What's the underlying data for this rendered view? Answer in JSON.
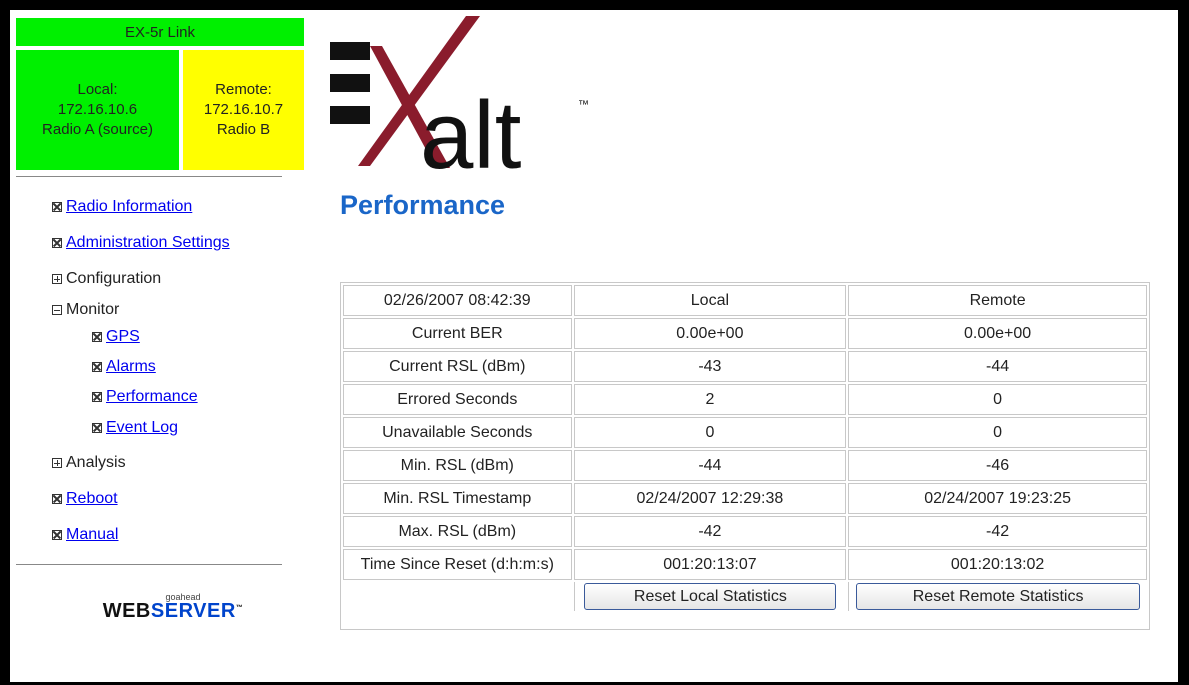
{
  "link_status": {
    "title": "EX-5r Link",
    "local": {
      "label": "Local:",
      "ip": "172.16.10.6",
      "radio": "Radio A (source)"
    },
    "remote": {
      "label": "Remote:",
      "ip": "172.16.10.7",
      "radio": "Radio B"
    },
    "colors": {
      "local_bg": "#00f000",
      "remote_bg": "#ffff00"
    }
  },
  "logo": {
    "text": "alt",
    "trademark": "™"
  },
  "nav": {
    "radio_information": "Radio Information",
    "administration_settings": "Administration Settings",
    "configuration": "Configuration",
    "monitor": "Monitor",
    "gps": "GPS",
    "alarms": "Alarms",
    "performance": "Performance",
    "event_log": "Event Log",
    "analysis": "Analysis",
    "reboot": "Reboot",
    "manual": "Manual"
  },
  "footer": {
    "small": "goahead",
    "web": "WEB",
    "server": "SERVER",
    "tm": "™"
  },
  "page": {
    "title": "Performance",
    "title_color": "#1a66c8"
  },
  "table": {
    "header": {
      "timestamp": "02/26/2007 08:42:39",
      "local": "Local",
      "remote": "Remote"
    },
    "rows": [
      {
        "label": "Current BER",
        "local": "0.00e+00",
        "remote": "0.00e+00"
      },
      {
        "label": "Current RSL (dBm)",
        "local": "-43",
        "remote": "-44"
      },
      {
        "label": "Errored Seconds",
        "local": "2",
        "remote": "0"
      },
      {
        "label": "Unavailable Seconds",
        "local": "0",
        "remote": "0"
      },
      {
        "label": "Min. RSL (dBm)",
        "local": "-44",
        "remote": "-46"
      },
      {
        "label": "Min. RSL Timestamp",
        "local": "02/24/2007 12:29:38",
        "remote": "02/24/2007 19:23:25"
      },
      {
        "label": "Max. RSL (dBm)",
        "local": "-42",
        "remote": "-42"
      },
      {
        "label": "Time Since Reset (d:h:m:s)",
        "local": "001:20:13:07",
        "remote": "001:20:13:02"
      }
    ],
    "buttons": {
      "reset_local": "Reset Local Statistics",
      "reset_remote": "Reset Remote Statistics"
    }
  }
}
